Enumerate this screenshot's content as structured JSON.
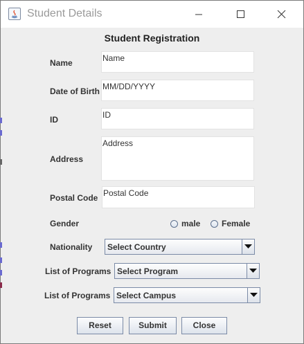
{
  "window": {
    "title": "Student Details"
  },
  "form": {
    "header": "Student Registration",
    "name": {
      "label": "Name",
      "value": "Name"
    },
    "dob": {
      "label": "Date of Birth",
      "value": "MM/DD/YYYY"
    },
    "id": {
      "label": "ID",
      "value": "ID"
    },
    "address": {
      "label": "Address",
      "value": "Address"
    },
    "postal": {
      "label": "Postal Code",
      "value": "Postal Code"
    },
    "gender": {
      "label": "Gender",
      "options": [
        "male",
        "Female"
      ]
    },
    "nationality": {
      "label": "Nationality",
      "selected": "Select Country"
    },
    "program": {
      "label": "List of Programs",
      "selected": "Select Program"
    },
    "campus": {
      "label": "List of Programs",
      "selected": "Select Campus"
    },
    "buttons": {
      "reset": "Reset",
      "submit": "Submit",
      "close": "Close"
    }
  },
  "colors": {
    "background": "#eeeeee",
    "field": "#ffffff",
    "title_text": "#9a9a9a",
    "accent": "#7a8aa6"
  }
}
